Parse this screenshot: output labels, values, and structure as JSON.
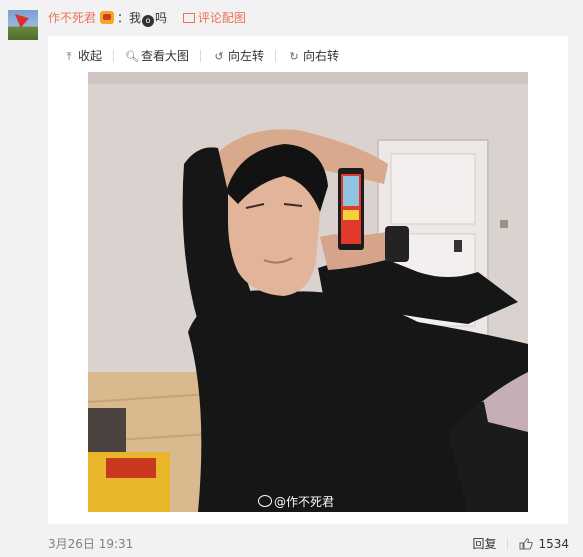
{
  "comment": {
    "username": "作不死君",
    "separator": "：",
    "text_before": "我",
    "emoji_glyph": "o",
    "text_after": "吗",
    "picture_link": "评论配图"
  },
  "toolbar": {
    "collapse": "收起",
    "view_large": "查看大图",
    "rotate_left": "向左转",
    "rotate_right": "向右转"
  },
  "image": {
    "watermark": "@作不死君"
  },
  "footer": {
    "date": "3月26日 19:31",
    "reply": "回复",
    "likes": "1534"
  },
  "colors": {
    "accent": "#eb7350",
    "background": "#f2f2f5",
    "muted": "#808080"
  }
}
